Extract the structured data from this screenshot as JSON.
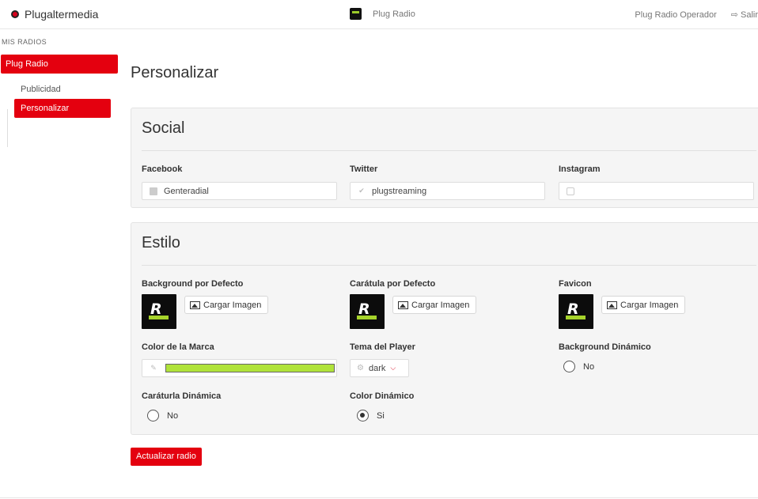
{
  "topbar": {
    "brand": "Plugaltermedia",
    "radio_title": "Plug Radio",
    "operator": "Plug Radio Operador",
    "logout": "Salir"
  },
  "sidebar": {
    "header": "MIS RADIOS",
    "radio": "Plug Radio",
    "items": [
      {
        "label": "Publicidad",
        "active": false
      },
      {
        "label": "Personalizar",
        "active": true
      }
    ]
  },
  "page": {
    "title": "Personalizar"
  },
  "social": {
    "title": "Social",
    "facebook_label": "Facebook",
    "facebook_value": "Genteradial",
    "twitter_label": "Twitter",
    "twitter_value": "plugstreaming",
    "instagram_label": "Instagram",
    "instagram_value": ""
  },
  "estilo": {
    "title": "Estilo",
    "background_label": "Background por Defecto",
    "caratula_label": "Carátula por Defecto",
    "favicon_label": "Favicon",
    "upload_label": "Cargar Imagen",
    "color_label": "Color de la Marca",
    "color_value": "#b0e33a",
    "tema_label": "Tema del Player",
    "tema_value": "dark",
    "bg_dinamico_label": "Background Dinámico",
    "bg_dinamico_value": "No",
    "caratula_dinamica_label": "Caráturla Dinámica",
    "caratula_dinamica_value": "No",
    "color_dinamico_label": "Color Dinámico",
    "color_dinamico_value": "Si"
  },
  "actions": {
    "submit": "Actualizar radio"
  },
  "colors": {
    "accent": "#e4000f",
    "brand_green": "#b0e33a"
  }
}
